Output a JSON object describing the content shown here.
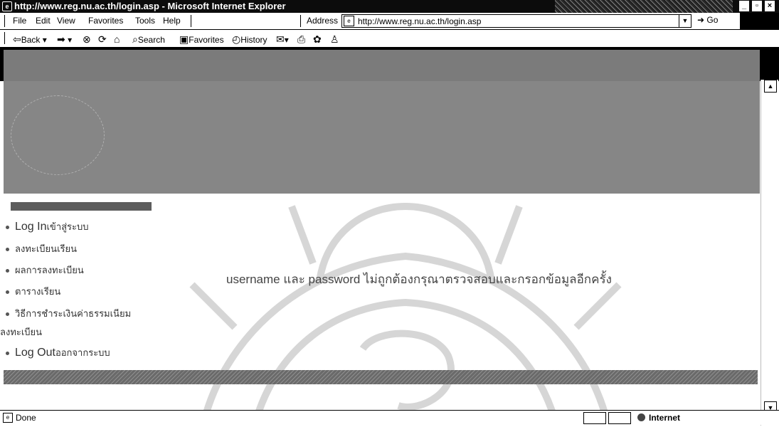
{
  "window": {
    "title": "http://www.reg.nu.ac.th/login.asp - Microsoft Internet Explorer",
    "min": "_",
    "max": "▫",
    "close": "×"
  },
  "menu": {
    "items": [
      "File",
      "Edit",
      "View",
      "Favorites",
      "Tools",
      "Help"
    ],
    "address_label": "Address",
    "address_value": "http://www.reg.nu.ac.th/login.asp",
    "go_label": "Go"
  },
  "toolbar": {
    "back": "Back",
    "search": "Search",
    "favorites": "Favorites",
    "history": "History"
  },
  "sidebar": {
    "items": [
      {
        "main": "Log In",
        "thai": "เข้าสู่ระบบ"
      },
      {
        "main": "",
        "thai": "ลงทะเบียนเรียน"
      },
      {
        "main": "",
        "thai": "ผลการลงทะเบียน"
      },
      {
        "main": "",
        "thai": "ตารางเรียน"
      },
      {
        "main": "",
        "thai": "วิธีการชำระเงินค่าธรรมเนียม"
      },
      {
        "main": "Log Out",
        "thai": "ออกจากระบบ"
      }
    ],
    "wrap_text": "ลงทะเบียน"
  },
  "message": "username และ password ไม่ถูกต้องกรุณาตรวจสอบและกรอกข้อมูลอีกครั้ง",
  "status": {
    "text": "Done",
    "zone": "Internet"
  }
}
